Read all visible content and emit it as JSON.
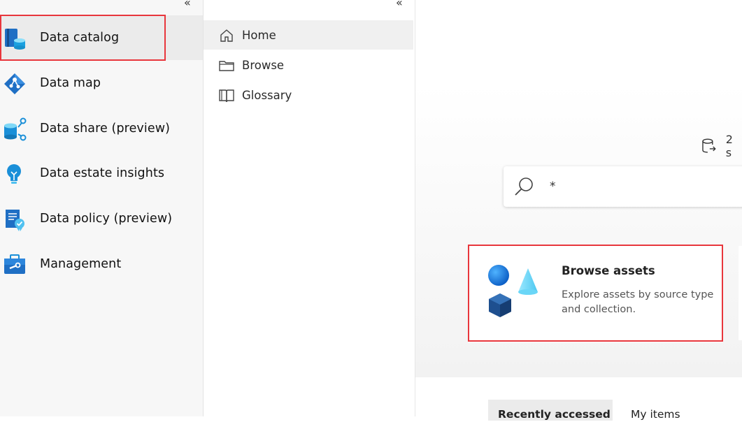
{
  "rail": {
    "collapse_glyph": "«",
    "items": [
      {
        "label": "Data catalog",
        "icon": "data-catalog-icon",
        "selected": true
      },
      {
        "label": "Data map",
        "icon": "data-map-icon"
      },
      {
        "label": "Data share (preview)",
        "icon": "data-share-icon"
      },
      {
        "label": "Data estate insights",
        "icon": "insights-bulb-icon"
      },
      {
        "label": "Data policy (preview)",
        "icon": "data-policy-icon"
      },
      {
        "label": "Management",
        "icon": "toolbox-icon"
      }
    ]
  },
  "subnav": {
    "collapse_glyph": "«",
    "items": [
      {
        "label": "Home",
        "icon": "home-icon",
        "selected": true
      },
      {
        "label": "Browse",
        "icon": "folder-icon"
      },
      {
        "label": "Glossary",
        "icon": "book-icon"
      }
    ]
  },
  "main": {
    "source_count": "2 s",
    "search": {
      "value": "*"
    },
    "browse_card": {
      "title": "Browse assets",
      "description": "Explore assets by source type and collection."
    },
    "tabs": [
      {
        "label": "Recently accessed",
        "selected": true
      },
      {
        "label": "My items"
      }
    ]
  },
  "colors": {
    "highlight": "#e8363c",
    "accent": "#0078d4"
  }
}
